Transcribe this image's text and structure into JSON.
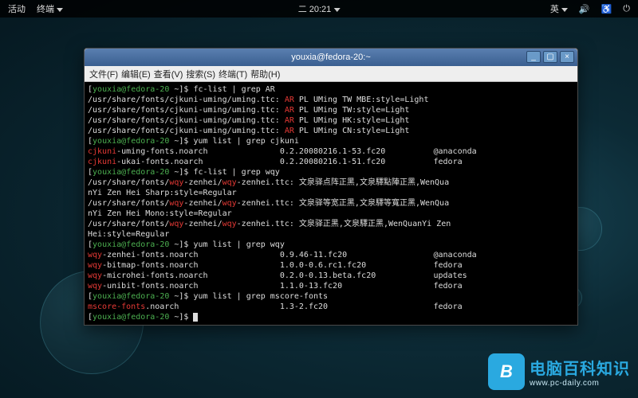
{
  "topbar": {
    "activities": "活动",
    "app": "终端",
    "clock": "二 20:21",
    "lang": "英",
    "vol_icon": "🔊",
    "acc_icon": "♿",
    "pwr_icon": "⏻"
  },
  "window": {
    "title": "youxia@fedora-20:~",
    "btn_min": "_",
    "btn_max": "▢",
    "btn_close": "×",
    "menu": {
      "file": "文件(F)",
      "edit": "编辑(E)",
      "view": "查看(V)",
      "search": "搜索(S)",
      "terminal": "终端(T)",
      "help": "帮助(H)"
    }
  },
  "term": {
    "prompt_user": "youxia@fedora-20",
    "prompt_path": "~",
    "lines": [
      {
        "type": "cmd",
        "cmd": "fc-list | grep AR"
      },
      {
        "type": "fc",
        "path": "/usr/share/fonts/cjkuni-uming/uming.ttc: ",
        "hi": "AR",
        "rest": " PL UMing TW MBE:style=Light"
      },
      {
        "type": "fc",
        "path": "/usr/share/fonts/cjkuni-uming/uming.ttc: ",
        "hi": "AR",
        "rest": " PL UMing TW:style=Light"
      },
      {
        "type": "fc",
        "path": "/usr/share/fonts/cjkuni-uming/uming.ttc: ",
        "hi": "AR",
        "rest": " PL UMing HK:style=Light"
      },
      {
        "type": "fc",
        "path": "/usr/share/fonts/cjkuni-uming/uming.ttc: ",
        "hi": "AR",
        "rest": " PL UMing CN:style=Light"
      },
      {
        "type": "cmd",
        "cmd": "yum list | grep cjkuni"
      },
      {
        "type": "yum",
        "hi": "cjkuni",
        "name": "-uming-fonts.noarch",
        "ver": "0.2.20080216.1-53.fc20",
        "repo": "@anaconda"
      },
      {
        "type": "yum",
        "hi": "cjkuni",
        "name": "-ukai-fonts.noarch",
        "ver": "0.2.20080216.1-51.fc20",
        "repo": "fedora"
      },
      {
        "type": "cmd",
        "cmd": "fc-list | grep wqy"
      },
      {
        "type": "fcw",
        "pre": "/usr/share/fonts/",
        "hi": "wqy",
        "mid": "-zenhei/",
        "hi2": "wqy",
        "post": "-zenhei.ttc: 文泉驿点阵正黑,文泉驛點陣正黑,WenQua"
      },
      {
        "type": "plain",
        "text": "nYi Zen Hei Sharp:style=Regular"
      },
      {
        "type": "fcw",
        "pre": "/usr/share/fonts/",
        "hi": "wqy",
        "mid": "-zenhei/",
        "hi2": "wqy",
        "post": "-zenhei.ttc: 文泉驿等宽正黑,文泉驛等寬正黑,WenQua"
      },
      {
        "type": "plain",
        "text": "nYi Zen Hei Mono:style=Regular"
      },
      {
        "type": "fcw",
        "pre": "/usr/share/fonts/",
        "hi": "wqy",
        "mid": "-zenhei/",
        "hi2": "wqy",
        "post": "-zenhei.ttc: 文泉驿正黑,文泉驛正黑,WenQuanYi Zen "
      },
      {
        "type": "plain",
        "text": "Hei:style=Regular"
      },
      {
        "type": "cmd",
        "cmd": "yum list | grep wqy"
      },
      {
        "type": "yum",
        "hi": "wqy",
        "name": "-zenhei-fonts.noarch",
        "ver": "0.9.46-11.fc20",
        "repo": "@anaconda"
      },
      {
        "type": "yum",
        "hi": "wqy",
        "name": "-bitmap-fonts.noarch",
        "ver": "1.0.0-0.6.rc1.fc20",
        "repo": "fedora"
      },
      {
        "type": "yum",
        "hi": "wqy",
        "name": "-microhei-fonts.noarch",
        "ver": "0.2.0-0.13.beta.fc20",
        "repo": "updates"
      },
      {
        "type": "yum",
        "hi": "wqy",
        "name": "-unibit-fonts.noarch",
        "ver": "1.1.0-13.fc20",
        "repo": "fedora"
      },
      {
        "type": "cmd",
        "cmd": "yum list | grep mscore-fonts"
      },
      {
        "type": "yum",
        "hi": "mscore-fonts",
        "name": ".noarch",
        "ver": "1.3-2.fc20",
        "repo": "fedora"
      },
      {
        "type": "prompt"
      }
    ]
  },
  "watermark": {
    "icon": "B",
    "cn": "电脑百科知识",
    "url": "www.pc-daily.com"
  }
}
